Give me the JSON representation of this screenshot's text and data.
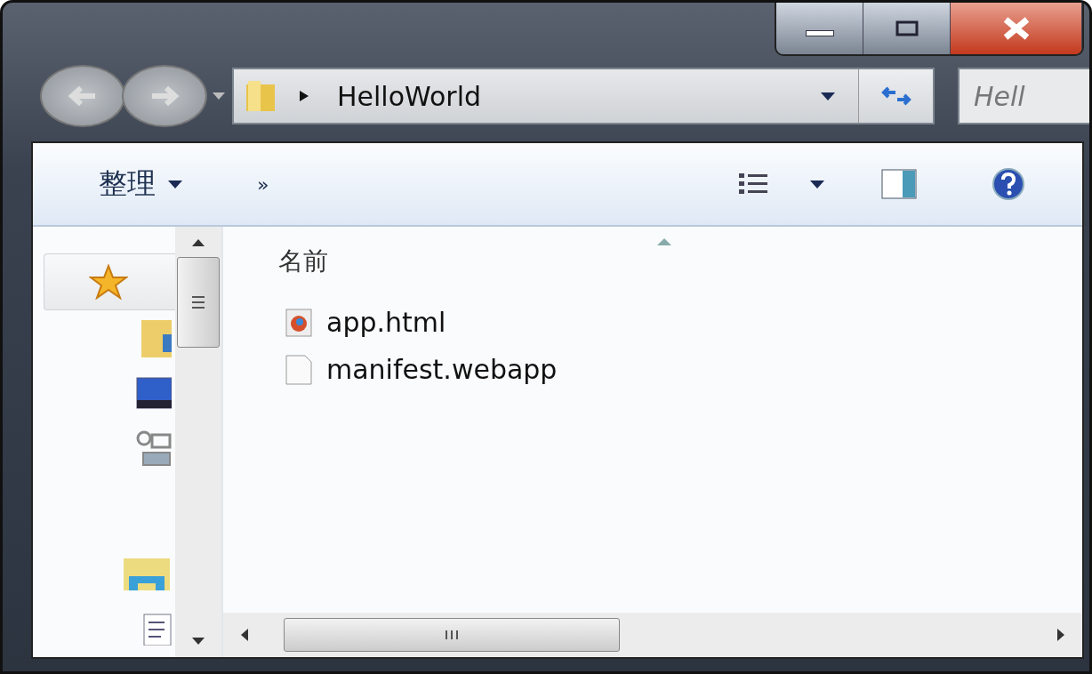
{
  "address": {
    "path": "HelloWorld"
  },
  "search": {
    "placeholder": "Hell"
  },
  "toolbar": {
    "organize": "整理",
    "more": "»"
  },
  "nav_pane": {
    "items": [
      {
        "kind": "favorites",
        "selected": true
      },
      {
        "kind": "libraries",
        "selected": false
      },
      {
        "kind": "computer",
        "selected": false
      },
      {
        "kind": "network",
        "selected": false
      },
      {
        "kind": "homegroup",
        "selected": false
      },
      {
        "kind": "document",
        "selected": false
      }
    ]
  },
  "file_list": {
    "column": "名前",
    "files": [
      {
        "name": "app.html",
        "kind": "html"
      },
      {
        "name": "manifest.webapp",
        "kind": "file"
      }
    ]
  }
}
